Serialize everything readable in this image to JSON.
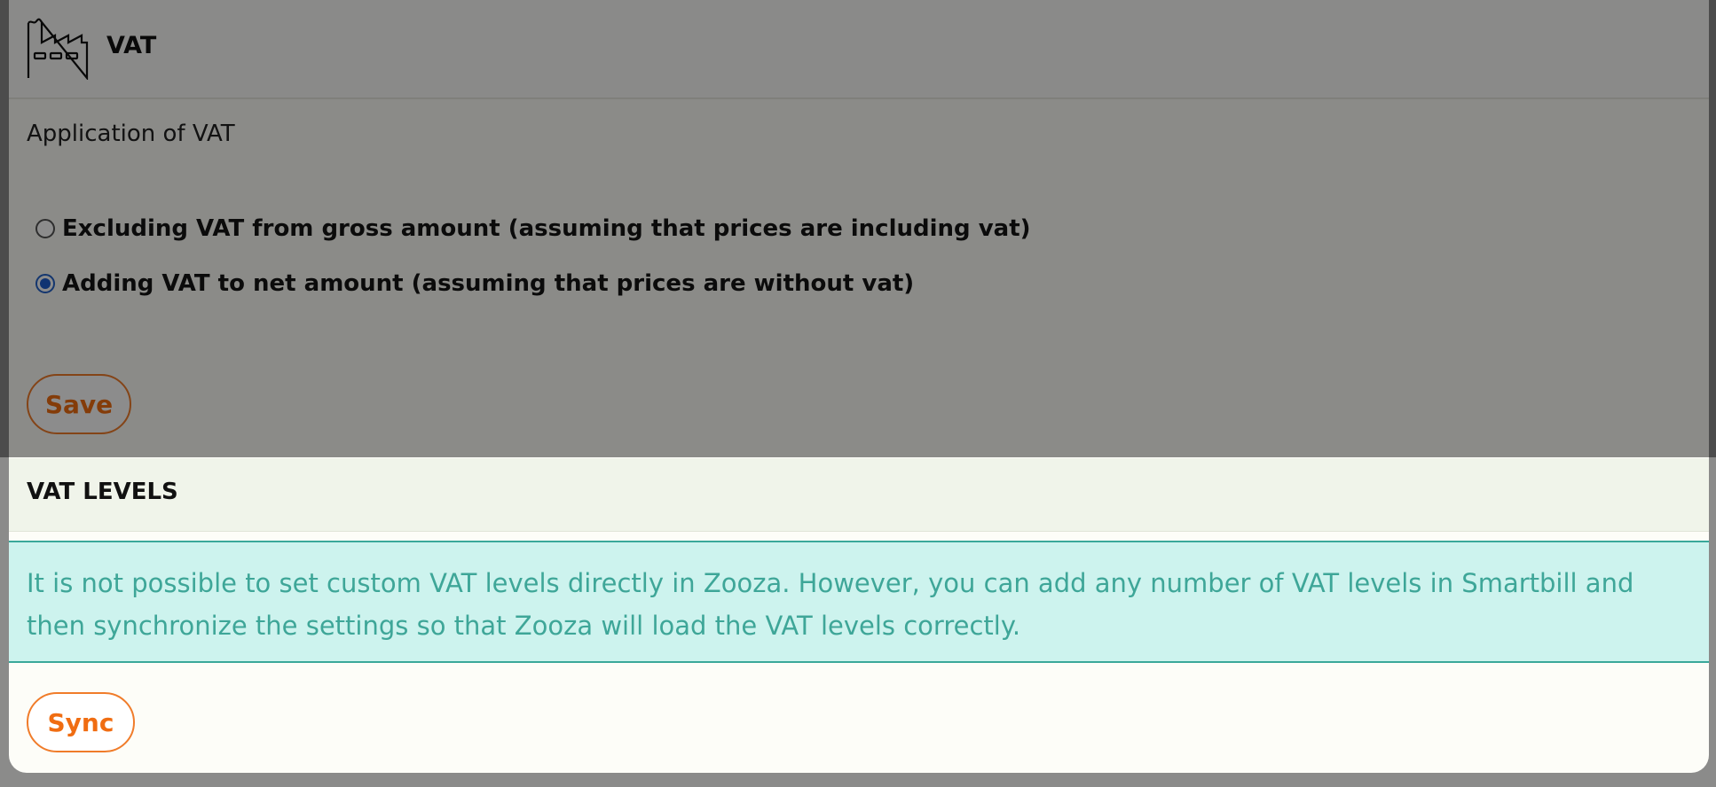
{
  "header": {
    "title": "VAT",
    "icon": "factory-icon"
  },
  "vat_application": {
    "label": "Application of VAT",
    "options": [
      {
        "label": "Excluding VAT from gross amount (assuming that prices are including vat)",
        "selected": false
      },
      {
        "label": "Adding VAT to net amount (assuming that prices are without vat)",
        "selected": true
      }
    ],
    "save_label": "Save"
  },
  "vat_levels": {
    "title": "VAT LEVELS",
    "info": "It is not possible to set custom VAT levels directly in Zooza. However, you can add any number of VAT levels in Smartbill and then synchronize the settings so that Zooza will load the VAT levels correctly.",
    "sync_label": "Sync"
  },
  "colors": {
    "accent": "#f06d12",
    "info_bg": "#cdf3ee",
    "info_text": "#3ea698",
    "radio_selected": "#1f5fd0"
  }
}
